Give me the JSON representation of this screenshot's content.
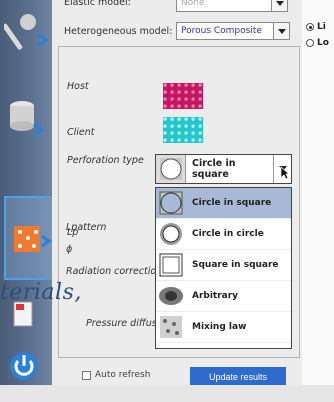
{
  "colors": {
    "accent": "#2d6ccc",
    "selection": "#a7b9d4",
    "host": "#c4175d",
    "client": "#22c6cc"
  },
  "model": {
    "elastic_label": "Elastic model:",
    "elastic_value": "None",
    "heterogeneous_label": "Heterogeneous model:",
    "heterogeneous_value": "Porous Composite"
  },
  "right_panel": {
    "options": [
      "Li",
      "Lo"
    ]
  },
  "labels": {
    "host": "Host",
    "client": "Client",
    "perforation_type": "Perforation type",
    "lp": "Lp",
    "lpattern": "Lpattern",
    "phi": "ϕ",
    "radiation_correction": "Radiation correction",
    "pressure_diffusion": "Pressure diffusion"
  },
  "perforation": {
    "selected": "Circle in square",
    "options": [
      "Circle in square",
      "Circle in circle",
      "Square in square",
      "Arbitrary",
      "Mixing law"
    ]
  },
  "watermark": "terials,",
  "bottom": {
    "auto_refresh": "Auto refresh",
    "update_button": "Update results"
  },
  "icons": [
    "tools-icon",
    "database-icon",
    "material-icon",
    "document-icon",
    "power-icon"
  ]
}
